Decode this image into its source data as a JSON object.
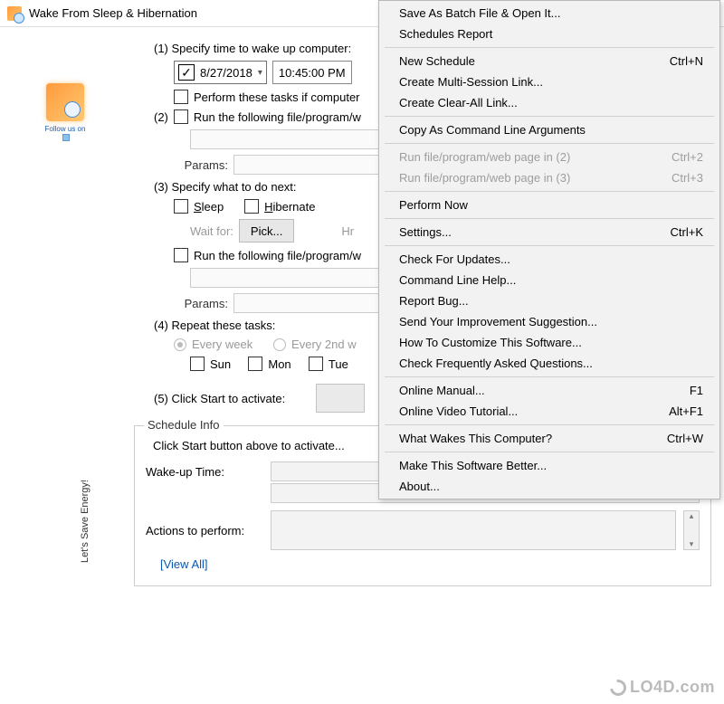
{
  "window": {
    "title": "Wake From Sleep & Hibernation"
  },
  "logo": {
    "caption": "Follow us on"
  },
  "step1": {
    "label": "(1) Specify time to wake up computer:",
    "date": "8/27/2018",
    "time": "10:45:00 PM",
    "perform_if": "Perform these tasks if computer"
  },
  "step2": {
    "label": "Run the following file/program/w",
    "prefix": "(2)",
    "params_label": "Params:"
  },
  "step3": {
    "label": "(3) Specify what to do next:",
    "sleep": "Sleep",
    "hibernate": "Hibernate",
    "wait_for": "Wait for:",
    "pick": "Pick...",
    "hr": "Hr",
    "run2": "Run the following file/program/w",
    "params_label": "Params:"
  },
  "step4": {
    "label": "(4) Repeat these tasks:",
    "every_week": "Every week",
    "every_2nd": "Every 2nd w",
    "days": [
      "Sun",
      "Mon",
      "Tue"
    ]
  },
  "step5": {
    "label": "(5) Click Start to activate:"
  },
  "schedule": {
    "legend": "Schedule Info",
    "hint": "Click Start button above to activate...",
    "wake_label": "Wake-up Time:",
    "actions_label": "Actions to perform:",
    "view_all": "[View All]"
  },
  "sidebar_text": "Let's Save Energy!",
  "menu": [
    {
      "type": "item",
      "label": "Save As Batch File & Open It...",
      "shortcut": ""
    },
    {
      "type": "item",
      "label": "Schedules Report",
      "shortcut": ""
    },
    {
      "type": "sep"
    },
    {
      "type": "item",
      "label": "New Schedule",
      "shortcut": "Ctrl+N"
    },
    {
      "type": "item",
      "label": "Create Multi-Session Link...",
      "shortcut": ""
    },
    {
      "type": "item",
      "label": "Create Clear-All Link...",
      "shortcut": ""
    },
    {
      "type": "sep"
    },
    {
      "type": "item",
      "label": "Copy As Command Line Arguments",
      "shortcut": ""
    },
    {
      "type": "sep"
    },
    {
      "type": "item",
      "label": "Run file/program/web page in (2)",
      "shortcut": "Ctrl+2",
      "disabled": true
    },
    {
      "type": "item",
      "label": "Run file/program/web page in (3)",
      "shortcut": "Ctrl+3",
      "disabled": true
    },
    {
      "type": "sep"
    },
    {
      "type": "item",
      "label": "Perform Now",
      "shortcut": ""
    },
    {
      "type": "sep"
    },
    {
      "type": "item",
      "label": "Settings...",
      "shortcut": "Ctrl+K"
    },
    {
      "type": "sep"
    },
    {
      "type": "item",
      "label": "Check For Updates...",
      "shortcut": ""
    },
    {
      "type": "item",
      "label": "Command Line Help...",
      "shortcut": ""
    },
    {
      "type": "item",
      "label": "Report Bug...",
      "shortcut": ""
    },
    {
      "type": "item",
      "label": "Send Your Improvement Suggestion...",
      "shortcut": ""
    },
    {
      "type": "item",
      "label": "How To Customize This Software...",
      "shortcut": ""
    },
    {
      "type": "item",
      "label": "Check Frequently Asked Questions...",
      "shortcut": ""
    },
    {
      "type": "sep"
    },
    {
      "type": "item",
      "label": "Online Manual...",
      "shortcut": "F1"
    },
    {
      "type": "item",
      "label": "Online Video Tutorial...",
      "shortcut": "Alt+F1"
    },
    {
      "type": "sep"
    },
    {
      "type": "item",
      "label": "What Wakes This Computer?",
      "shortcut": "Ctrl+W"
    },
    {
      "type": "sep"
    },
    {
      "type": "item",
      "label": "Make This Software Better...",
      "shortcut": ""
    },
    {
      "type": "item",
      "label": "About...",
      "shortcut": ""
    }
  ],
  "watermark": "LO4D.com"
}
